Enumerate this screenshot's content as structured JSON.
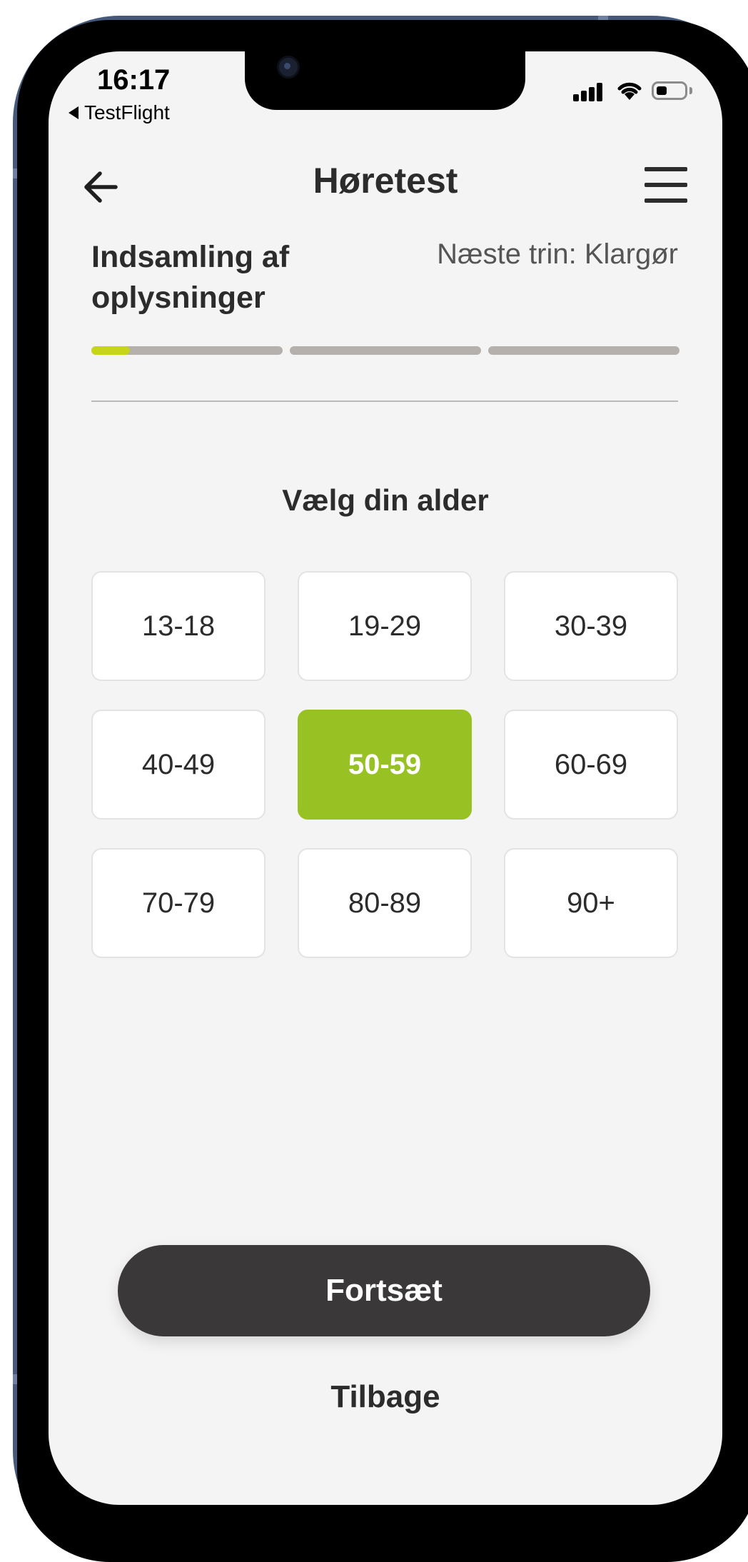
{
  "status_bar": {
    "time": "16:17",
    "back_app": "TestFlight"
  },
  "header": {
    "title": "Høretest"
  },
  "steps": {
    "current": "Indsamling af oplysninger",
    "next": "Næste trin: Klargør",
    "segments": 3,
    "current_segment_progress": 0.2,
    "active_color": "#c6d41a",
    "inactive_color": "#b6b0ad"
  },
  "question": "Vælg din alder",
  "age_options": [
    "13-18",
    "19-29",
    "30-39",
    "40-49",
    "50-59",
    "60-69",
    "70-79",
    "80-89",
    "90+"
  ],
  "selected_age": "50-59",
  "selected_color": "#98c124",
  "buttons": {
    "continue": "Fortsæt",
    "back": "Tilbage"
  }
}
